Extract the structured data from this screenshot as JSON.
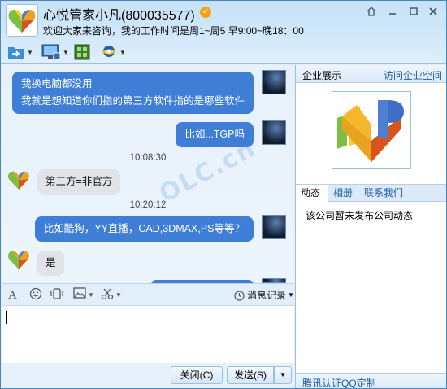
{
  "window": {
    "contact_name": "心悦管家小凡(800035577)",
    "signature": "欢迎大家来咨询，我的工作时间是周1~周5 早9:00~晚18：00"
  },
  "toolbar": {
    "icons": [
      "transfer-file-icon",
      "remote-desktop-icon",
      "apps-icon",
      "business-icon"
    ]
  },
  "chat": {
    "messages": [
      {
        "side": "self",
        "lines": [
          "我换电脑都没用",
          "我就是想知道你们指的第三方软件指的是哪些软件"
        ]
      },
      {
        "side": "self",
        "text": "比如...TGP吗"
      },
      {
        "side": "time",
        "text": "10:08:30"
      },
      {
        "side": "other",
        "text": "第三方=非官方"
      },
      {
        "side": "time",
        "text": "10:20:12"
      },
      {
        "side": "self",
        "text": "比如酷狗，YY直播，CAD,3DMAX,PS等等？"
      },
      {
        "side": "other",
        "text": "是"
      }
    ]
  },
  "input_toolbar": {
    "history_label": "消息记录"
  },
  "input": {
    "value": ""
  },
  "actions": {
    "close_label": "关闭(C)",
    "send_label": "发送(S)"
  },
  "panel": {
    "title": "企业展示",
    "link": "访问企业空间",
    "tabs": [
      "动态",
      "相册",
      "联系我们"
    ],
    "empty_feed": "该公司暂未发布公司动态",
    "footer_link": "腾讯认证QQ定制"
  },
  "watermark": "OLC.cn",
  "colors": {
    "self_bubble": "#3f7ed6",
    "other_bubble": "#e0e3e7",
    "link": "#1b5fa6"
  }
}
